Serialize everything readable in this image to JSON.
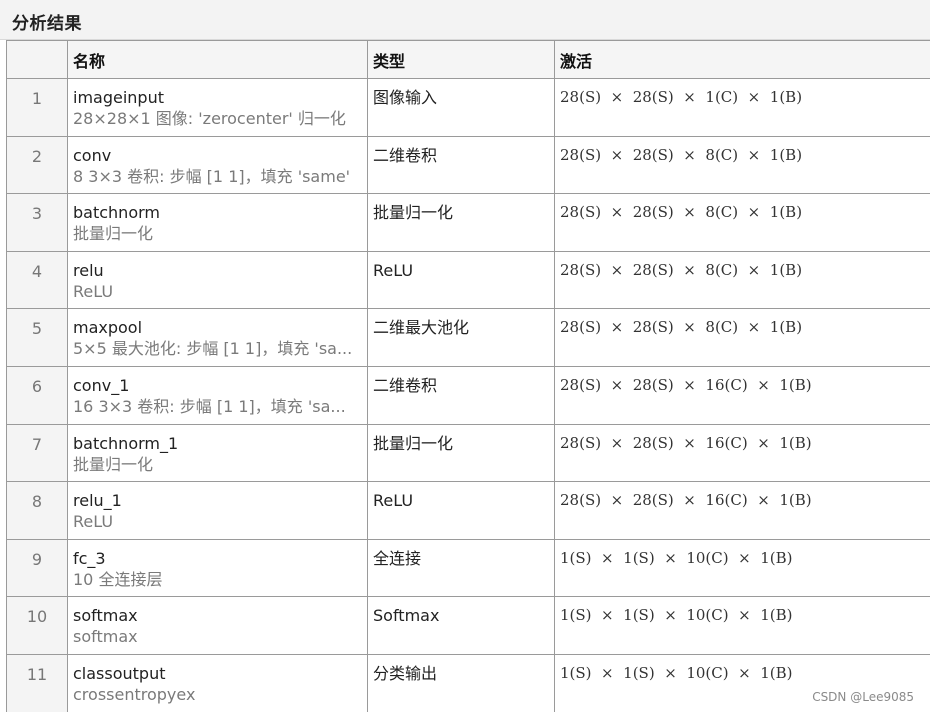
{
  "panel": {
    "title": "分析结果"
  },
  "table": {
    "headers": {
      "index": "",
      "name": "名称",
      "type": "类型",
      "activation": "激活"
    },
    "rows": [
      {
        "index": "1",
        "name": "imageinput",
        "desc": "28×28×1 图像: 'zerocenter' 归一化",
        "type": "图像输入",
        "activation": "28(S)  ×  28(S)  ×  1(C)  ×  1(B)"
      },
      {
        "index": "2",
        "name": "conv",
        "desc": "8 3×3 卷积: 步幅 [1 1]，填充 'same'",
        "type": "二维卷积",
        "activation": "28(S)  ×  28(S)  ×  8(C)  ×  1(B)"
      },
      {
        "index": "3",
        "name": "batchnorm",
        "desc": "批量归一化",
        "type": "批量归一化",
        "activation": "28(S)  ×  28(S)  ×  8(C)  ×  1(B)"
      },
      {
        "index": "4",
        "name": "relu",
        "desc": "ReLU",
        "type": "ReLU",
        "activation": "28(S)  ×  28(S)  ×  8(C)  ×  1(B)"
      },
      {
        "index": "5",
        "name": "maxpool",
        "desc": "5×5 最大池化: 步幅 [1 1]，填充 'sa...",
        "type": "二维最大池化",
        "activation": "28(S)  ×  28(S)  ×  8(C)  ×  1(B)"
      },
      {
        "index": "6",
        "name": "conv_1",
        "desc": "16 3×3 卷积: 步幅 [1 1]，填充 'sa...",
        "type": "二维卷积",
        "activation": "28(S)  ×  28(S)  ×  16(C)  ×  1(B)"
      },
      {
        "index": "7",
        "name": "batchnorm_1",
        "desc": "批量归一化",
        "type": "批量归一化",
        "activation": "28(S)  ×  28(S)  ×  16(C)  ×  1(B)"
      },
      {
        "index": "8",
        "name": "relu_1",
        "desc": "ReLU",
        "type": "ReLU",
        "activation": "28(S)  ×  28(S)  ×  16(C)  ×  1(B)"
      },
      {
        "index": "9",
        "name": "fc_3",
        "desc": "10 全连接层",
        "type": "全连接",
        "activation": "1(S)  ×  1(S)  ×  10(C)  ×  1(B)"
      },
      {
        "index": "10",
        "name": "softmax",
        "desc": "softmax",
        "type": "Softmax",
        "activation": "1(S)  ×  1(S)  ×  10(C)  ×  1(B)"
      },
      {
        "index": "11",
        "name": "classoutput",
        "desc": "crossentropyex",
        "type": "分类输出",
        "activation": "1(S)  ×  1(S)  ×  10(C)  ×  1(B)"
      }
    ]
  },
  "watermark": "CSDN @Lee9085"
}
